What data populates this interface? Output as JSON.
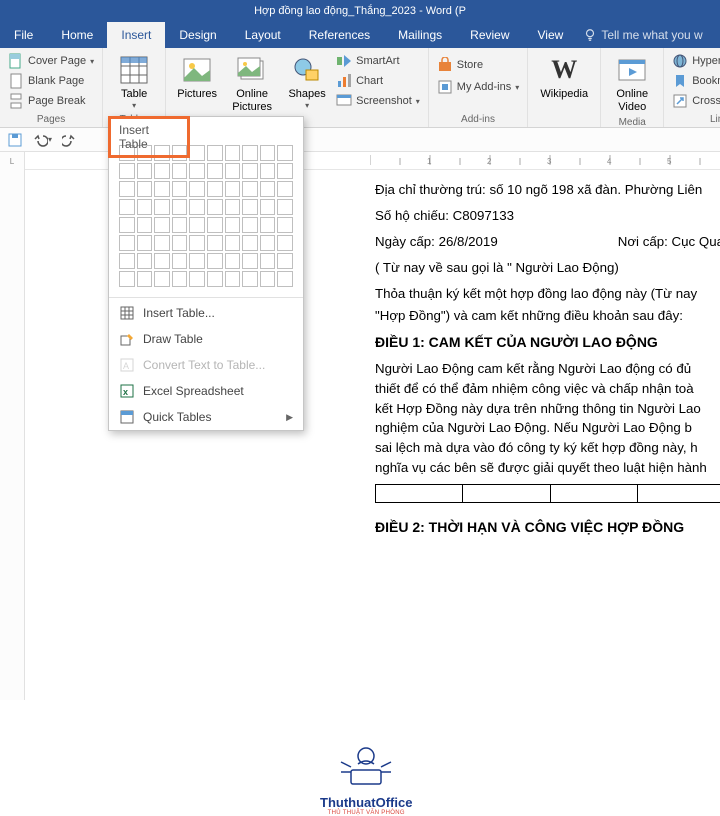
{
  "title": "Hợp đồng lao động_Thắng_2023 - Word (P",
  "tabs": {
    "file": "File",
    "home": "Home",
    "insert": "Insert",
    "design": "Design",
    "layout": "Layout",
    "references": "References",
    "mailings": "Mailings",
    "review": "Review",
    "view": "View",
    "tell": "Tell me what you w"
  },
  "ribbon": {
    "pages": {
      "label": "Pages",
      "cover": "Cover Page",
      "blank": "Blank Page",
      "break": "Page Break"
    },
    "tables": {
      "label": "Tables",
      "table": "Table"
    },
    "illus": {
      "pictures": "Pictures",
      "online": "Online Pictures",
      "shapes": "Shapes",
      "smartart": "SmartArt",
      "chart": "Chart",
      "screenshot": "Screenshot"
    },
    "addins": {
      "label": "Add-ins",
      "store": "Store",
      "myaddins": "My Add-ins"
    },
    "wikipedia": "Wikipedia",
    "media": {
      "label": "Media",
      "video": "Online Video"
    },
    "links": {
      "label": "Links",
      "hyperlink": "Hyperlink",
      "bookmark": "Bookmark",
      "crossref": "Cross-reference"
    }
  },
  "dropdown": {
    "header": "Insert Table",
    "items": {
      "insert": "Insert Table...",
      "draw": "Draw Table",
      "convert": "Convert Text to Table...",
      "excel": "Excel Spreadsheet",
      "quick": "Quick Tables"
    }
  },
  "doc": {
    "addr": "Địa chỉ thường trú: số 10 ngõ 198 xã đàn. Phường Liên",
    "passport": "Số hộ chiếu: C8097133",
    "issued": "Ngày cấp: 26/8/2019",
    "place": "Nơi cấp: Cục Qua",
    "alias": " ( Từ nay về sau gọi là \" Người Lao Động)",
    "agreement1": "Thỏa thuận ký kết một hợp đồng lao động này (Từ nay",
    "agreement2": "\"Hợp Đồng\") và cam kết những điều khoản sau đây:",
    "h1": "ĐIỀU 1: CAM KẾT CỦA NGƯỜI LAO ĐỘNG",
    "p1": "Người Lao Động cam kết rằng Người Lao động có đủ",
    "p2": "thiết để có thể đảm nhiệm công việc và chấp nhận toà",
    "p3": "kết Hợp Đồng này dựa trên những thông tin Người Lao",
    "p4": "nghiệm của Người Lao Động. Nếu Người Lao Động b",
    "p5": "sai lệch mà dựa vào đó công ty ký kết hợp đồng này, h",
    "p6": "nghĩa vụ các bên sẽ được giải quyết theo luật hiện hành",
    "h2": "ĐIỀU 2: THỜI HẠN VÀ CÔNG VIỆC HỢP ĐỒNG",
    "brand": "ThuthuatOffice",
    "tag": "THỦ THUẬT VĂN PHÒNG"
  }
}
